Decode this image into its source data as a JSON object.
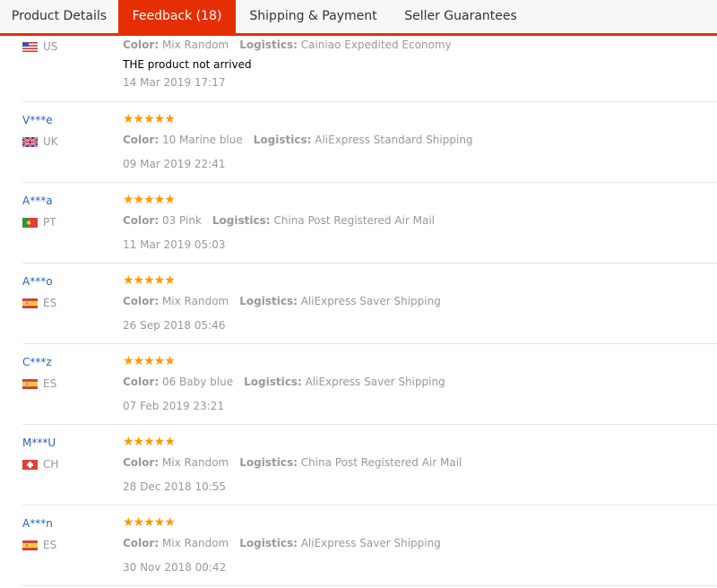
{
  "tabs": [
    {
      "label": "Product Details",
      "active": false
    },
    {
      "label": "Feedback (18)",
      "active": true
    },
    {
      "label": "Shipping & Payment",
      "active": false
    },
    {
      "label": "Seller Guarantees",
      "active": false
    }
  ],
  "colors": {
    "accent": "#e62e04",
    "star": "#ff9900",
    "username": "#2a5ebf"
  },
  "labels": {
    "color": "Color:",
    "logistics": "Logistics:"
  },
  "reviews": [
    {
      "user": "",
      "country": "US",
      "flag": "us-flag-icon",
      "stars": "",
      "rating": null,
      "color": "Mix Random",
      "logistics": "Cainiao Expedited Economy",
      "comment": "THE product not arrived",
      "date": "14 Mar 2019 17:17"
    },
    {
      "user": "V***e",
      "country": "UK",
      "flag": "uk-flag-icon",
      "stars": "★★★★★",
      "rating": 5,
      "color": "10 Marine blue",
      "logistics": "AliExpress Standard Shipping",
      "comment": "",
      "date": "09 Mar 2019 22:41"
    },
    {
      "user": "A***a",
      "country": "PT",
      "flag": "pt-flag-icon",
      "stars": "★★★★★",
      "rating": 5,
      "color": "03 Pink",
      "logistics": "China Post Registered Air Mail",
      "comment": "",
      "date": "11 Mar 2019 05:03"
    },
    {
      "user": "A***o",
      "country": "ES",
      "flag": "es-flag-icon",
      "stars": "★★★★★",
      "rating": 5,
      "color": "Mix Random",
      "logistics": "AliExpress Saver Shipping",
      "comment": "",
      "date": "26 Sep 2018 05:46"
    },
    {
      "user": "C***z",
      "country": "ES",
      "flag": "es-flag-icon",
      "stars": "★★★★★",
      "rating": 5,
      "color": "06 Baby blue",
      "logistics": "AliExpress Saver Shipping",
      "comment": "",
      "date": "07 Feb 2019 23:21"
    },
    {
      "user": "M***U",
      "country": "CH",
      "flag": "ch-flag-icon",
      "stars": "★★★★★",
      "rating": 5,
      "color": "Mix Random",
      "logistics": "China Post Registered Air Mail",
      "comment": "",
      "date": "28 Dec 2018 10:55"
    },
    {
      "user": "A***n",
      "country": "ES",
      "flag": "es-flag-icon",
      "stars": "★★★★★",
      "rating": 5,
      "color": "Mix Random",
      "logistics": "AliExpress Saver Shipping",
      "comment": "",
      "date": "30 Nov 2018 00:42"
    }
  ]
}
